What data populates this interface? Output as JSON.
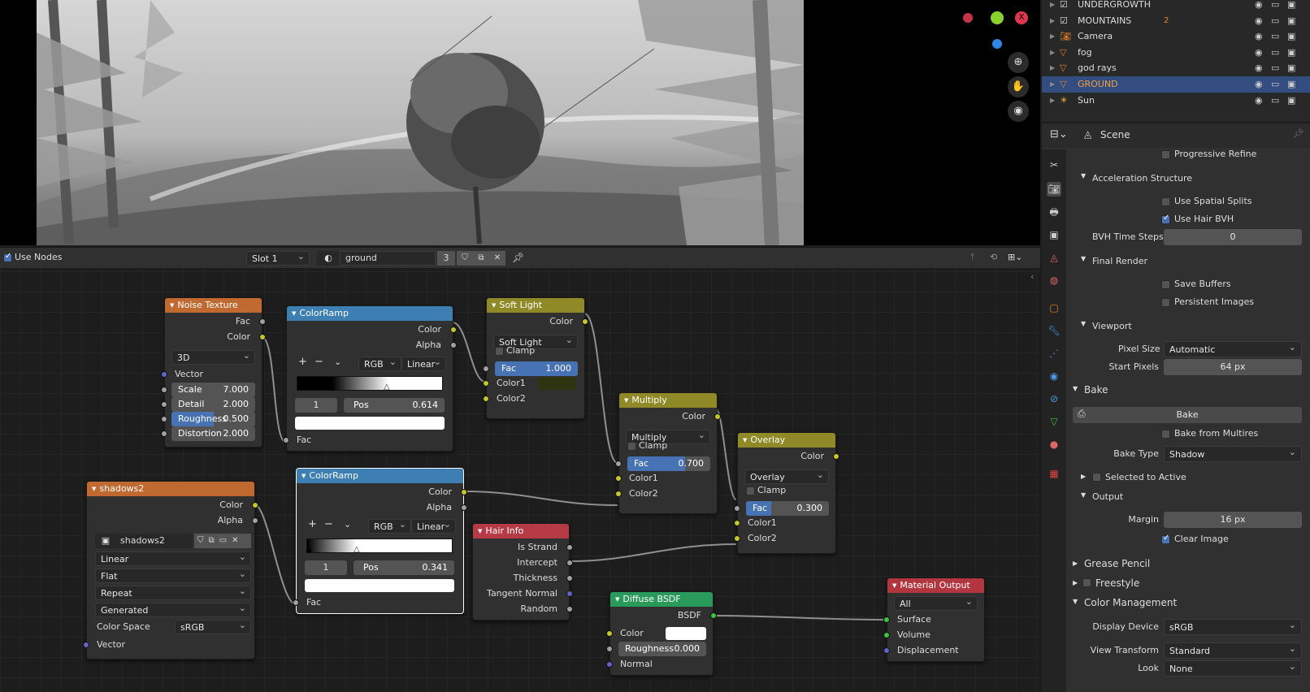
{
  "outliner": {
    "items": [
      {
        "name": "UNDERGROWTH",
        "icon": "collection-icon"
      },
      {
        "name": "MOUNTAINS",
        "icon": "collection-icon",
        "badge": "2"
      },
      {
        "name": "Camera",
        "icon": "camera-icon"
      },
      {
        "name": "fog",
        "icon": "mesh-icon"
      },
      {
        "name": "god rays",
        "icon": "mesh-icon"
      },
      {
        "name": "GROUND",
        "icon": "mesh-icon",
        "selected": true
      },
      {
        "name": "Sun",
        "icon": "light-icon"
      }
    ]
  },
  "node_header": {
    "use_nodes": "Use Nodes",
    "slot": "Slot 1",
    "material": "ground",
    "users": "3"
  },
  "nodes": {
    "noise": {
      "title": "Noise Texture",
      "out_fac": "Fac",
      "out_color": "Color",
      "dim": "3D",
      "vector": "Vector",
      "scale_l": "Scale",
      "scale_v": "7.000",
      "detail_l": "Detail",
      "detail_v": "2.000",
      "rough_l": "Roughness",
      "rough_v": "0.500",
      "rough_frac": 0.5,
      "dist_l": "Distortion",
      "dist_v": "2.000"
    },
    "ramp1": {
      "title": "ColorRamp",
      "out_color": "Color",
      "out_alpha": "Alpha",
      "mode": "RGB",
      "interp": "Linear",
      "index": "1",
      "pos_l": "Pos",
      "pos_v": "0.614",
      "fac": "Fac",
      "plus": "+",
      "minus": "−"
    },
    "soft": {
      "title": "Soft Light",
      "out": "Color",
      "blend": "Soft Light",
      "clamp": "Clamp",
      "fac_l": "Fac",
      "fac_v": "1.000",
      "fac_frac": 1.0,
      "c1": "Color1",
      "c2": "Color2",
      "c1_color": "#2e3310"
    },
    "multiply": {
      "title": "Multiply",
      "out": "Color",
      "blend": "Multiply",
      "clamp": "Clamp",
      "fac_l": "Fac",
      "fac_v": "0.700",
      "fac_frac": 0.7,
      "c1": "Color1",
      "c2": "Color2"
    },
    "overlay": {
      "title": "Overlay",
      "out": "Color",
      "blend": "Overlay",
      "clamp": "Clamp",
      "fac_l": "Fac",
      "fac_v": "0.300",
      "fac_frac": 0.3,
      "c1": "Color1",
      "c2": "Color2"
    },
    "shadows": {
      "title": "shadows2",
      "out_color": "Color",
      "out_alpha": "Alpha",
      "image": "shadows2",
      "interp": "Linear",
      "proj": "Flat",
      "ext": "Repeat",
      "src": "Generated",
      "cs_l": "Color Space",
      "cs_v": "sRGB",
      "vector": "Vector"
    },
    "ramp2": {
      "title": "ColorRamp",
      "out_color": "Color",
      "out_alpha": "Alpha",
      "mode": "RGB",
      "interp": "Linear",
      "index": "1",
      "pos_l": "Pos",
      "pos_v": "0.341",
      "fac": "Fac",
      "plus": "+",
      "minus": "−"
    },
    "hair": {
      "title": "Hair Info",
      "o1": "Is Strand",
      "o2": "Intercept",
      "o3": "Thickness",
      "o4": "Tangent Normal",
      "o5": "Random"
    },
    "diffuse": {
      "title": "Diffuse BSDF",
      "out": "BSDF",
      "color": "Color",
      "rough_l": "Roughness",
      "rough_v": "0.000",
      "normal": "Normal"
    },
    "output": {
      "title": "Material Output",
      "target": "All",
      "surface": "Surface",
      "volume": "Volume",
      "disp": "Displacement"
    }
  },
  "props": {
    "context": "Scene",
    "progressive": "Progressive Refine",
    "accel": "Acceleration Structure",
    "spatial": "Use Spatial Splits",
    "hairbvh": "Use Hair BVH",
    "bvh_l": "BVH Time Steps",
    "bvh_v": "0",
    "final": "Final Render",
    "save_buffers": "Save Buffers",
    "persistent": "Persistent Images",
    "viewport": "Viewport",
    "pixel_l": "Pixel Size",
    "pixel_v": "Automatic",
    "start_l": "Start Pixels",
    "start_v": "64 px",
    "bake": "Bake",
    "bake_btn": "Bake",
    "multires": "Bake from Multires",
    "baketype_l": "Bake Type",
    "baketype_v": "Shadow",
    "selected": "Selected to Active",
    "output": "Output",
    "margin_l": "Margin",
    "margin_v": "16 px",
    "clear": "Clear Image",
    "grease": "Grease Pencil",
    "freestyle": "Freestyle",
    "colorman": "Color Management",
    "display_l": "Display Device",
    "display_v": "sRGB",
    "view_l": "View Transform",
    "view_v": "Standard",
    "look_l": "Look",
    "look_v": "None"
  },
  "colors": {
    "selected_row": "#334d80",
    "accent": "#4772b3"
  }
}
